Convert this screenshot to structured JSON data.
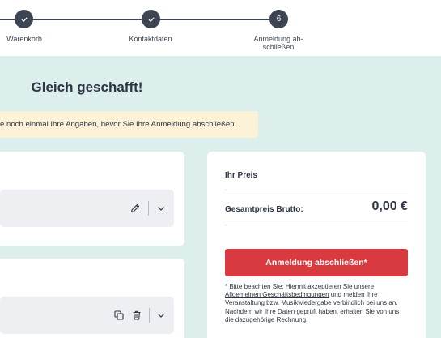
{
  "stepper": {
    "steps": [
      {
        "label": "Warenkorb",
        "state": "done",
        "icon": "check-icon"
      },
      {
        "label": "Kontaktdaten",
        "state": "done",
        "icon": "check-icon"
      },
      {
        "label_line1": "Anmeldung ab-",
        "label_line2": "schließen",
        "number": "6",
        "state": "active"
      }
    ]
  },
  "main": {
    "title": "Gleich geschafft!",
    "hint": "e noch einmal Ihre Angaben, bevor Sie Ihre Anmeldung abschließen."
  },
  "items": [
    {
      "icons": [
        "pencil-icon",
        "chevron-down-icon"
      ]
    },
    {
      "icons": [
        "copy-icon",
        "trash-icon",
        "chevron-down-icon"
      ]
    }
  ],
  "summary": {
    "heading": "Ihr Preis",
    "total_label": "Gesamtpreis Brutto:",
    "total_value": "0,00 €",
    "submit_label": "Anmeldung abschließen*",
    "note_before": "* Bitte beachten Sie: Hiermit akzeptieren Sie unsere ",
    "note_link": "Allgemeinen Geschäftsbedingungen",
    "note_after": " und melden Ihre Veranstaltung bzw. Musikwiedergabe verbindlich bei uns an. Nachdem wir Ihre Daten geprüft haben, erhalten Sie von uns die dazugehörige Rechnung."
  },
  "colors": {
    "page_bg": "#dcefed",
    "step_dark": "#3d4452",
    "hint_bg": "#fcf2d7",
    "submit_bg": "#d93a3f"
  }
}
